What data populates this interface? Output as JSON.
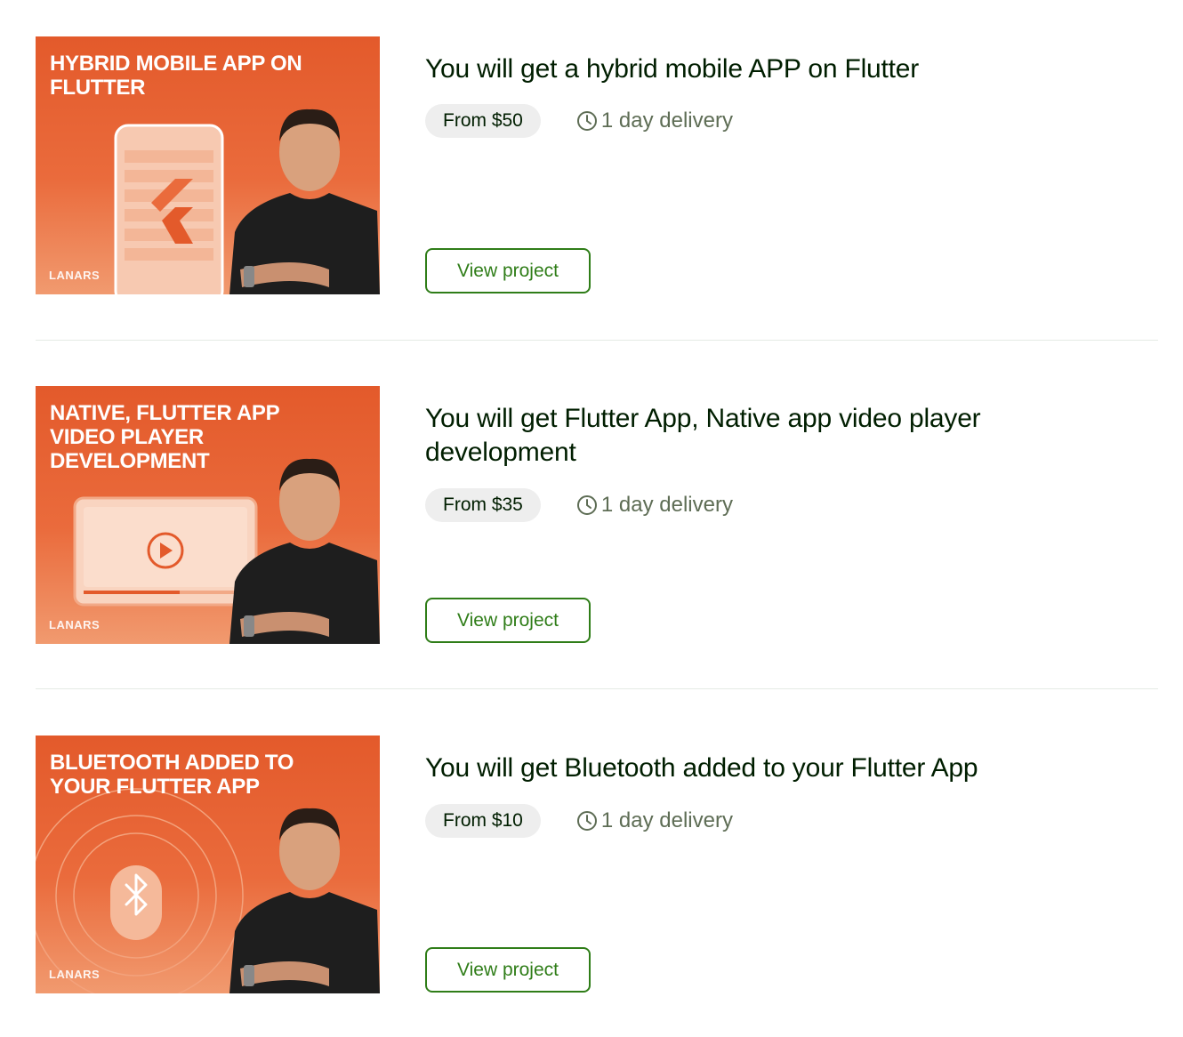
{
  "colors": {
    "accent": "#2f7d18",
    "thumbnail_orange": "#e35a2b",
    "badge_bg": "#eeeeee",
    "muted_text": "#5e6d55"
  },
  "projects": [
    {
      "thumbnail_title": "HYBRID MOBILE APP ON FLUTTER",
      "thumbnail_brand": "LANARS",
      "thumbnail_illustration": "phone-with-flutter-logo",
      "title": "You will get a hybrid mobile APP on Flutter",
      "price": "From $50",
      "delivery": "1 day delivery",
      "button_label": "View project"
    },
    {
      "thumbnail_title": "NATIVE, FLUTTER APP VIDEO PLAYER DEVELOPMENT",
      "thumbnail_brand": "LANARS",
      "thumbnail_illustration": "video-player-window",
      "title": "You will get Flutter App, Native app video player development",
      "price": "From $35",
      "delivery": "1 day delivery",
      "button_label": "View project"
    },
    {
      "thumbnail_title": "BLUETOOTH ADDED TO YOUR FLUTTER APP",
      "thumbnail_brand": "LANARS",
      "thumbnail_illustration": "bluetooth-symbol",
      "title": "You will get Bluetooth added to your Flutter App",
      "price": "From $10",
      "delivery": "1 day delivery",
      "button_label": "View project"
    }
  ]
}
